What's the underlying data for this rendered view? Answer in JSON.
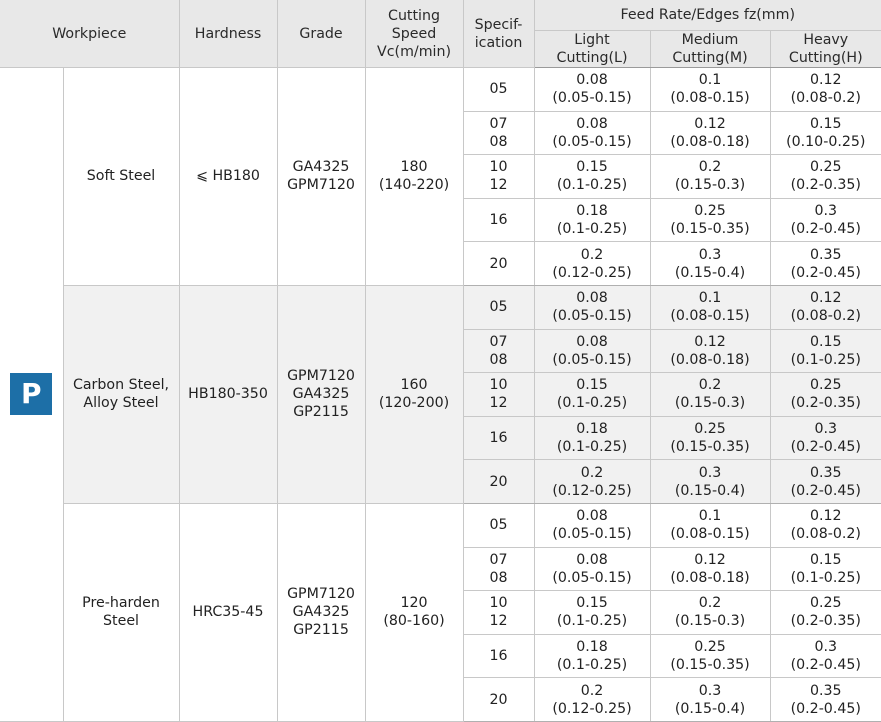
{
  "header": {
    "workpiece": "Workpiece",
    "hardness": "Hardness",
    "grade": "Grade",
    "cutting_speed": [
      "Cutting",
      "Speed",
      "Vc(m/min)"
    ],
    "specification": [
      "Specif-",
      "ication"
    ],
    "feed_rate": "Feed Rate/Edges fz(mm)",
    "light": [
      "Light",
      "Cutting(L)"
    ],
    "medium": [
      "Medium",
      "Cutting(M)"
    ],
    "heavy": [
      "Heavy",
      "Cutting(H)"
    ]
  },
  "iso": "P",
  "groups": [
    {
      "workpiece": [
        "Soft Steel"
      ],
      "hardness": "⩽ HB180",
      "grade": [
        "GA4325",
        "GPM7120"
      ],
      "speed": [
        "180",
        "(140-220)"
      ],
      "rows": [
        {
          "spec": [
            "05"
          ],
          "light": [
            "0.08",
            "(0.05-0.15)"
          ],
          "medium": [
            "0.1",
            "(0.08-0.15)"
          ],
          "heavy": [
            "0.12",
            "(0.08-0.2)"
          ]
        },
        {
          "spec": [
            "07",
            "08"
          ],
          "light": [
            "0.08",
            "(0.05-0.15)"
          ],
          "medium": [
            "0.12",
            "(0.08-0.18)"
          ],
          "heavy": [
            "0.15",
            "(0.10-0.25)"
          ]
        },
        {
          "spec": [
            "10",
            "12"
          ],
          "light": [
            "0.15",
            "(0.1-0.25)"
          ],
          "medium": [
            "0.2",
            "(0.15-0.3)"
          ],
          "heavy": [
            "0.25",
            "(0.2-0.35)"
          ]
        },
        {
          "spec": [
            "16"
          ],
          "light": [
            "0.18",
            "(0.1-0.25)"
          ],
          "medium": [
            "0.25",
            "(0.15-0.35)"
          ],
          "heavy": [
            "0.3",
            "(0.2-0.45)"
          ]
        },
        {
          "spec": [
            "20"
          ],
          "light": [
            "0.2",
            "(0.12-0.25)"
          ],
          "medium": [
            "0.3",
            "(0.15-0.4)"
          ],
          "heavy": [
            "0.35",
            "(0.2-0.45)"
          ]
        }
      ]
    },
    {
      "workpiece": [
        "Carbon Steel,",
        "Alloy Steel"
      ],
      "hardness": "HB180-350",
      "grade": [
        "GPM7120",
        "GA4325",
        "GP2115"
      ],
      "speed": [
        "160",
        "(120-200)"
      ],
      "rows": [
        {
          "spec": [
            "05"
          ],
          "light": [
            "0.08",
            "(0.05-0.15)"
          ],
          "medium": [
            "0.1",
            "(0.08-0.15)"
          ],
          "heavy": [
            "0.12",
            "(0.08-0.2)"
          ]
        },
        {
          "spec": [
            "07",
            "08"
          ],
          "light": [
            "0.08",
            "(0.05-0.15)"
          ],
          "medium": [
            "0.12",
            "(0.08-0.18)"
          ],
          "heavy": [
            "0.15",
            "(0.1-0.25)"
          ]
        },
        {
          "spec": [
            "10",
            "12"
          ],
          "light": [
            "0.15",
            "(0.1-0.25)"
          ],
          "medium": [
            "0.2",
            "(0.15-0.3)"
          ],
          "heavy": [
            "0.25",
            "(0.2-0.35)"
          ]
        },
        {
          "spec": [
            "16"
          ],
          "light": [
            "0.18",
            "(0.1-0.25)"
          ],
          "medium": [
            "0.25",
            "(0.15-0.35)"
          ],
          "heavy": [
            "0.3",
            "(0.2-0.45)"
          ]
        },
        {
          "spec": [
            "20"
          ],
          "light": [
            "0.2",
            "(0.12-0.25)"
          ],
          "medium": [
            "0.3",
            "(0.15-0.4)"
          ],
          "heavy": [
            "0.35",
            "(0.2-0.45)"
          ]
        }
      ]
    },
    {
      "workpiece": [
        "Pre-harden",
        "Steel"
      ],
      "hardness": "HRC35-45",
      "grade": [
        "GPM7120",
        "GA4325",
        "GP2115"
      ],
      "speed": [
        "120",
        "(80-160)"
      ],
      "rows": [
        {
          "spec": [
            "05"
          ],
          "light": [
            "0.08",
            "(0.05-0.15)"
          ],
          "medium": [
            "0.1",
            "(0.08-0.15)"
          ],
          "heavy": [
            "0.12",
            "(0.08-0.2)"
          ]
        },
        {
          "spec": [
            "07",
            "08"
          ],
          "light": [
            "0.08",
            "(0.05-0.15)"
          ],
          "medium": [
            "0.12",
            "(0.08-0.18)"
          ],
          "heavy": [
            "0.15",
            "(0.1-0.25)"
          ]
        },
        {
          "spec": [
            "10",
            "12"
          ],
          "light": [
            "0.15",
            "(0.1-0.25)"
          ],
          "medium": [
            "0.2",
            "(0.15-0.3)"
          ],
          "heavy": [
            "0.25",
            "(0.2-0.35)"
          ]
        },
        {
          "spec": [
            "16"
          ],
          "light": [
            "0.18",
            "(0.1-0.25)"
          ],
          "medium": [
            "0.25",
            "(0.15-0.35)"
          ],
          "heavy": [
            "0.3",
            "(0.2-0.45)"
          ]
        },
        {
          "spec": [
            "20"
          ],
          "light": [
            "0.2",
            "(0.12-0.25)"
          ],
          "medium": [
            "0.3",
            "(0.15-0.4)"
          ],
          "heavy": [
            "0.35",
            "(0.2-0.45)"
          ]
        }
      ]
    }
  ],
  "colors": {
    "iso_badge": "#1d6fa7",
    "header_bg": "#e8e8e8",
    "shaded_group_bg": "#f1f1f1"
  }
}
